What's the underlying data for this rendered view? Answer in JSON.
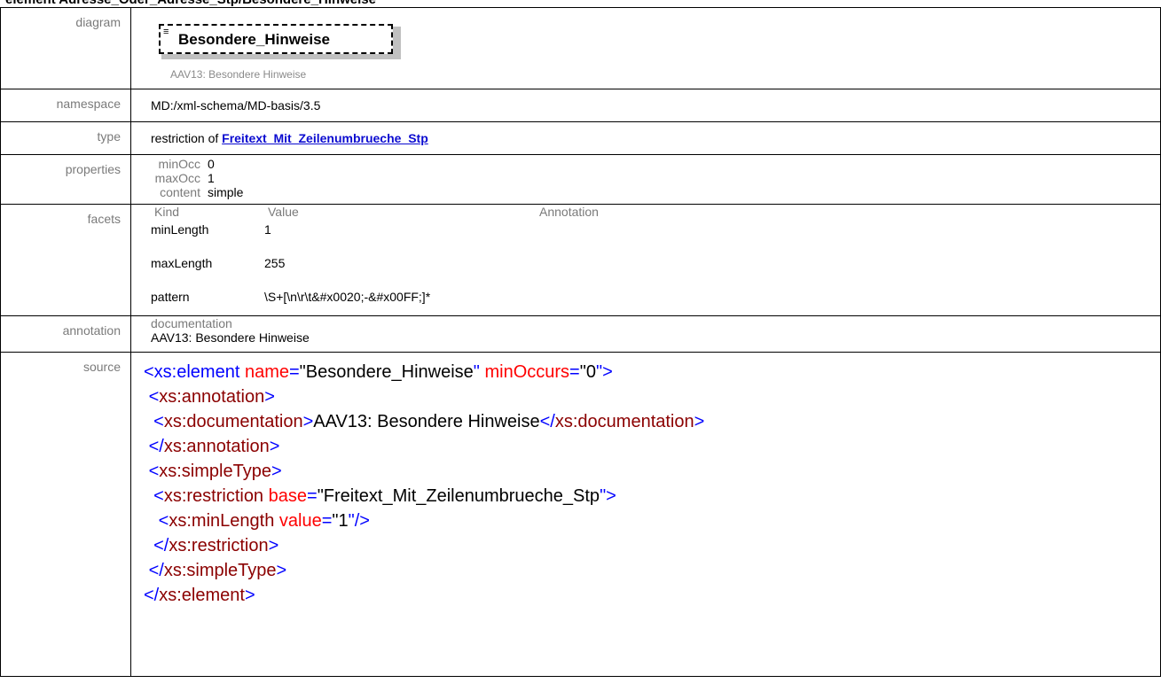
{
  "page_title": "element Adresse_Oder_Adresse_Stp/Besondere_Hinweise",
  "rows": {
    "diagram_label": "diagram",
    "namespace_label": "namespace",
    "type_label": "type",
    "properties_label": "properties",
    "facets_label": "facets",
    "annotation_label": "annotation",
    "source_label": "source"
  },
  "diagram": {
    "element_name": "Besondere_Hinweise",
    "documentation": "AAV13: Besondere Hinweise",
    "icon": "element-icon"
  },
  "namespace": "MD:/xml-schema/MD-basis/3.5",
  "type": {
    "prefix": "restriction of ",
    "link": "Freitext_Mit_Zeilenumbrueche_Stp"
  },
  "properties": [
    {
      "key": "minOcc",
      "value": "0"
    },
    {
      "key": "maxOcc",
      "value": "1"
    },
    {
      "key": "content",
      "value": "simple"
    }
  ],
  "facets": {
    "headers": {
      "kind": "Kind",
      "value": "Value",
      "annotation": "Annotation"
    },
    "rows": [
      {
        "kind": "minLength",
        "value": "1"
      },
      {
        "kind": "maxLength",
        "value": "255"
      },
      {
        "kind": "pattern",
        "value": "\\S+[\\n\\r\\t&#x0020;-&#x00FF;]*"
      }
    ]
  },
  "annotation": {
    "label": "documentation",
    "text": "AAV13: Besondere Hinweise"
  },
  "source": {
    "el_open": "<xs:element",
    "attr_name": " name",
    "eq": "=",
    "q": "\"",
    "name_val": "Besondere_Hinweise",
    "attr_minoccurs": " minOccurs",
    "minoccurs_val": "0",
    "gt": ">",
    "lt": "<",
    "lt_slash": "</",
    "slash_gt": "/>",
    "annotation_tag": "xs:annotation",
    "documentation_tag": "xs:documentation",
    "documentation_text": "AAV13: Besondere Hinweise",
    "simpletype_tag": "xs:simpleType",
    "restriction_tag": "xs:restriction",
    "attr_base": " base",
    "base_val": "Freitext_Mit_Zeilenumbrueche_Stp",
    "minlength_tag": "xs:minLength",
    "attr_value": " value",
    "minlength_val": "1",
    "element_tag": "xs:element"
  },
  "colors": {
    "bracket": "#0000ff",
    "tag": "#8b0000",
    "attr": "#ff0000",
    "link": "#0b0bd0",
    "label": "#7a7a7a"
  }
}
